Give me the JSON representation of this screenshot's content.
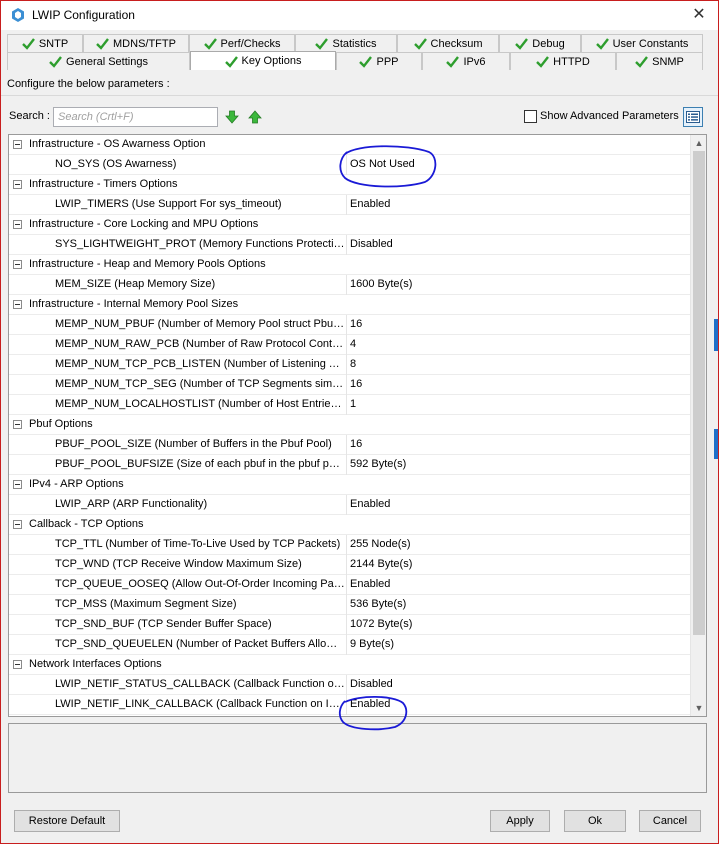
{
  "window": {
    "title": "LWIP Configuration"
  },
  "tabs": {
    "row1": [
      "SNTP",
      "MDNS/TFTP",
      "Perf/Checks",
      "Statistics",
      "Checksum",
      "Debug",
      "User Constants"
    ],
    "row2": [
      "General Settings",
      "Key Options",
      "PPP",
      "IPv6",
      "HTTPD",
      "SNMP"
    ],
    "active": "Key Options"
  },
  "instruction": "Configure the below parameters :",
  "search": {
    "label": "Search :",
    "placeholder": "Search (Crtl+F)"
  },
  "advanced": {
    "label": "Show Advanced Parameters",
    "checked": false
  },
  "params": [
    {
      "type": "group",
      "label": "Infrastructure - OS Awarness Option"
    },
    {
      "type": "param",
      "name": "NO_SYS (OS Awarness)",
      "value": "OS Not Used"
    },
    {
      "type": "group",
      "label": "Infrastructure - Timers Options"
    },
    {
      "type": "param",
      "name": "LWIP_TIMERS (Use Support For sys_timeout)",
      "value": "Enabled"
    },
    {
      "type": "group",
      "label": "Infrastructure - Core Locking and MPU Options"
    },
    {
      "type": "param",
      "name": "SYS_LIGHTWEIGHT_PROT (Memory Functions Protection)",
      "value": "Disabled"
    },
    {
      "type": "group",
      "label": "Infrastructure - Heap and Memory Pools Options"
    },
    {
      "type": "param",
      "name": "MEM_SIZE (Heap Memory Size)",
      "value": "1600 Byte(s)"
    },
    {
      "type": "group",
      "label": "Infrastructure - Internal Memory Pool Sizes"
    },
    {
      "type": "param",
      "name": "MEMP_NUM_PBUF (Number of Memory Pool struct Pbufs)",
      "value": "16"
    },
    {
      "type": "param",
      "name": "MEMP_NUM_RAW_PCB (Number of Raw Protocol Control ...",
      "value": "4"
    },
    {
      "type": "param",
      "name": "MEMP_NUM_TCP_PCB_LISTEN (Number of Listening TCP ...",
      "value": "8"
    },
    {
      "type": "param",
      "name": "MEMP_NUM_TCP_SEG (Number of TCP Segments simultan...",
      "value": "16"
    },
    {
      "type": "param",
      "name": "MEMP_NUM_LOCALHOSTLIST (Number of Host Entries in t...",
      "value": "1"
    },
    {
      "type": "group",
      "label": "Pbuf Options"
    },
    {
      "type": "param",
      "name": "PBUF_POOL_SIZE (Number of Buffers in the Pbuf Pool)",
      "value": "16"
    },
    {
      "type": "param",
      "name": "PBUF_POOL_BUFSIZE (Size of each pbuf in the pbuf pool)",
      "value": "592 Byte(s)"
    },
    {
      "type": "group",
      "label": "IPv4 - ARP Options"
    },
    {
      "type": "param",
      "name": "LWIP_ARP (ARP Functionality)",
      "value": "Enabled"
    },
    {
      "type": "group",
      "label": "Callback - TCP Options"
    },
    {
      "type": "param",
      "name": "TCP_TTL (Number of Time-To-Live Used by TCP Packets)",
      "value": "255 Node(s)"
    },
    {
      "type": "param",
      "name": "TCP_WND (TCP Receive Window Maximum Size)",
      "value": "2144 Byte(s)"
    },
    {
      "type": "param",
      "name": "TCP_QUEUE_OOSEQ (Allow Out-Of-Order Incoming Packe...",
      "value": "Enabled"
    },
    {
      "type": "param",
      "name": "TCP_MSS (Maximum Segment Size)",
      "value": "536 Byte(s)"
    },
    {
      "type": "param",
      "name": "TCP_SND_BUF (TCP Sender Buffer Space)",
      "value": "1072 Byte(s)"
    },
    {
      "type": "param",
      "name": "TCP_SND_QUEUELEN (Number of Packet Buffers Allowed ...",
      "value": "9 Byte(s)"
    },
    {
      "type": "group",
      "label": "Network Interfaces Options"
    },
    {
      "type": "param",
      "name": "LWIP_NETIF_STATUS_CALLBACK (Callback Function on In...",
      "value": "Disabled"
    },
    {
      "type": "param",
      "name": "LWIP_NETIF_LINK_CALLBACK (Callback Function on Inter...",
      "value": "Enabled"
    }
  ],
  "buttons": {
    "restore": "Restore Default",
    "apply": "Apply",
    "ok": "Ok",
    "cancel": "Cancel"
  },
  "colors": {
    "check_green": "#2e9e2e",
    "annotation_blue": "#1a1ad6",
    "window_border": "#c81e1e"
  }
}
